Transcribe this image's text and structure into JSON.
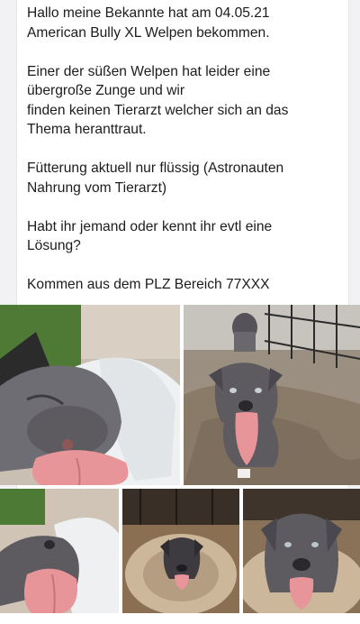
{
  "post": {
    "paragraphs": [
      "Hallo meine Bekannte hat am 04.05.21\nAmerican Bully XL Welpen bekommen.",
      "Einer der süßen Welpen hat leider eine\nübergroße Zunge und wir\nfinden keinen Tierarzt welcher sich an das\nThema heranttraut.",
      "Fütterung aktuell nur flüssig (Astronauten\nNahrung vom Tierarzt)",
      "Habt ihr jemand oder kennt ihr evtl eine\nLösung?",
      "Kommen aus dem PLZ Bereich 77XXX"
    ]
  },
  "photos": [
    {
      "icon": "puppy-sleeping-tongue-photo"
    },
    {
      "icon": "puppy-sitting-tongue-photo"
    },
    {
      "icon": "puppy-tongue-closeup-photo"
    },
    {
      "icon": "puppy-in-bed-photo"
    },
    {
      "icon": "puppy-face-photo"
    }
  ],
  "colors": {
    "text": "#1c1c1e",
    "card": "#ffffff",
    "background": "#f2f2f4",
    "tongue": "#e8959a",
    "puppy_fur": "#5d5a60"
  }
}
